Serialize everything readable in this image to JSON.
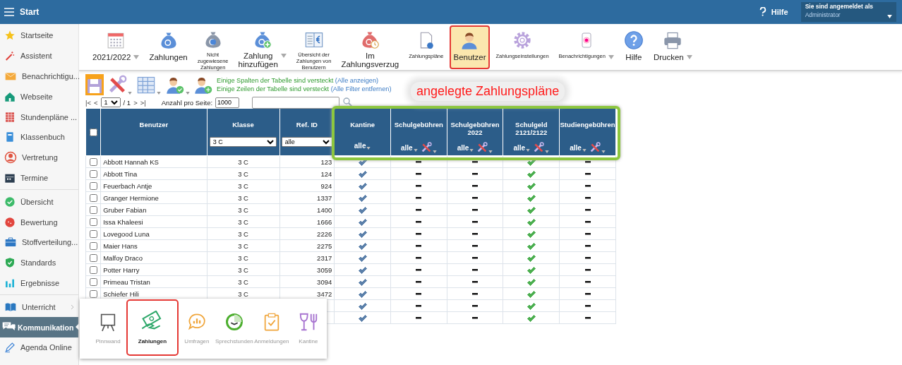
{
  "topbar": {
    "title": "Start",
    "help": "Hilfe",
    "login_label": "Sie sind angemeldet als",
    "user": "Administrator"
  },
  "sidebar": {
    "groups": [
      [
        {
          "label": "Startseite",
          "selected": false,
          "expandable": false
        },
        {
          "label": "Assistent",
          "selected": false,
          "expandable": false
        },
        {
          "label": "Benachrichtigu...",
          "selected": false,
          "expandable": false
        },
        {
          "label": "Webseite",
          "selected": false,
          "expandable": false
        },
        {
          "label": "Stundenpläne ...",
          "selected": false,
          "expandable": false
        },
        {
          "label": "Klassenbuch",
          "selected": false,
          "expandable": false
        },
        {
          "label": "Vertretung",
          "selected": false,
          "expandable": false
        },
        {
          "label": "Termine",
          "selected": false,
          "expandable": false
        }
      ],
      [
        {
          "label": "Übersicht",
          "selected": false,
          "expandable": false
        },
        {
          "label": "Bewertung",
          "selected": false,
          "expandable": false
        },
        {
          "label": "Stoffverteilung...",
          "selected": false,
          "expandable": false
        },
        {
          "label": "Standards",
          "selected": false,
          "expandable": false
        },
        {
          "label": "Ergebnisse",
          "selected": false,
          "expandable": false
        }
      ],
      [
        {
          "label": "Unterricht",
          "selected": false,
          "expandable": true
        },
        {
          "label": "Kommunikation",
          "selected": true,
          "expandable": false
        },
        {
          "label": "Agenda Online",
          "selected": false,
          "expandable": false
        }
      ]
    ]
  },
  "toolbar": {
    "items": [
      {
        "label": "2021/2022",
        "small": false,
        "dropdown": true,
        "selected": false,
        "highlighted": false
      },
      {
        "label": "Zahlungen",
        "small": false,
        "dropdown": false,
        "selected": false,
        "highlighted": false
      },
      {
        "label": "Nicht\nzugewiesene\nZahlungen",
        "small": true,
        "dropdown": false,
        "selected": false,
        "highlighted": false
      },
      {
        "label": "Zahlung\nhinzufügen",
        "small": false,
        "dropdown": true,
        "selected": false,
        "highlighted": false
      },
      {
        "label": "Übersicht der\nZahlungen von\nBenutzern",
        "small": true,
        "dropdown": false,
        "selected": false,
        "highlighted": false
      },
      {
        "label": "Im\nZahlungsverzug",
        "small": false,
        "dropdown": false,
        "selected": false,
        "highlighted": false
      },
      {
        "label": "Zahlungspläne",
        "small": true,
        "dropdown": false,
        "selected": false,
        "highlighted": false
      },
      {
        "label": "Benutzer",
        "small": false,
        "dropdown": false,
        "selected": true,
        "highlighted": true
      },
      {
        "label": "Zahlungseinstellungen",
        "small": true,
        "dropdown": false,
        "selected": false,
        "highlighted": false
      },
      {
        "label": "Benachrichtigungen",
        "small": true,
        "dropdown": true,
        "selected": false,
        "highlighted": false
      },
      {
        "label": "Hilfe",
        "small": false,
        "dropdown": false,
        "selected": false,
        "highlighted": false
      },
      {
        "label": "Drucken",
        "small": false,
        "dropdown": true,
        "selected": false,
        "highlighted": false
      }
    ]
  },
  "table_tools": [
    {
      "selected": true,
      "dropdown": false
    },
    {
      "selected": false,
      "dropdown": true
    },
    {
      "selected": false,
      "dropdown": true
    },
    {
      "selected": false,
      "dropdown": true
    },
    {
      "selected": false,
      "dropdown": false
    }
  ],
  "notices": [
    {
      "text": "Einige Spalten der Tabelle sind versteckt",
      "link": "(Alle anzeigen)"
    },
    {
      "text": "Einige Zeilen der Tabelle sind versteckt",
      "link": "(Alle Filter entfernen)"
    }
  ],
  "pager": {
    "first": "|<",
    "prev": "<",
    "page": "1",
    "of": "/ 1",
    "next": ">",
    "last": ">|",
    "per_page_label": "Anzahl pro Seite:",
    "per_page": "1000"
  },
  "annotation": {
    "text": "angelegte Zahlungspläne"
  },
  "table": {
    "select_all": false,
    "plans_highlighted": true,
    "columns": [
      {
        "label": "Benutzer",
        "kind": "name"
      },
      {
        "label": "Klasse",
        "kind": "select",
        "filter": "3 C"
      },
      {
        "label": "Ref. ID",
        "kind": "select",
        "filter": "alle"
      },
      {
        "label": "Kantine",
        "kind": "plan",
        "filter": "alle",
        "tools": false,
        "color": "#5b80aa"
      },
      {
        "label": "Schulgebühren",
        "kind": "plan",
        "filter": "alle",
        "tools": true
      },
      {
        "label": "Schulgebühren\n2022",
        "kind": "plan",
        "filter": "alle",
        "tools": true
      },
      {
        "label": "Schulgeld\n2121/2122",
        "kind": "plan",
        "filter": "alle",
        "tools": true,
        "color": "#4caf50"
      },
      {
        "label": "Studiengebühren",
        "kind": "plan",
        "filter": "alle",
        "tools": true
      }
    ],
    "rows": [
      {
        "checked": false,
        "name": "Abbott Hannah KS",
        "klasse": "3 C",
        "ref": "123",
        "plans": [
          true,
          false,
          false,
          true,
          false
        ]
      },
      {
        "checked": false,
        "name": "Abbott Tina",
        "klasse": "3 C",
        "ref": "124",
        "plans": [
          true,
          false,
          false,
          true,
          false
        ]
      },
      {
        "checked": false,
        "name": "Feuerbach Antje",
        "klasse": "3 C",
        "ref": "924",
        "plans": [
          true,
          false,
          false,
          true,
          false
        ]
      },
      {
        "checked": false,
        "name": "Granger Hermione",
        "klasse": "3 C",
        "ref": "1337",
        "plans": [
          true,
          false,
          false,
          true,
          false
        ]
      },
      {
        "checked": false,
        "name": "Gruber Fabian",
        "klasse": "3 C",
        "ref": "1400",
        "plans": [
          true,
          false,
          false,
          true,
          false
        ]
      },
      {
        "checked": false,
        "name": "Issa Khaleesi",
        "klasse": "3 C",
        "ref": "1666",
        "plans": [
          true,
          false,
          false,
          true,
          false
        ]
      },
      {
        "checked": false,
        "name": "Lovegood Luna",
        "klasse": "3 C",
        "ref": "2226",
        "plans": [
          true,
          false,
          false,
          true,
          false
        ]
      },
      {
        "checked": false,
        "name": "Maier Hans",
        "klasse": "3 C",
        "ref": "2275",
        "plans": [
          true,
          false,
          false,
          true,
          false
        ]
      },
      {
        "checked": false,
        "name": "Malfoy Draco",
        "klasse": "3 C",
        "ref": "2317",
        "plans": [
          true,
          false,
          false,
          true,
          false
        ]
      },
      {
        "checked": false,
        "name": "Potter Harry",
        "klasse": "3 C",
        "ref": "3059",
        "plans": [
          true,
          false,
          false,
          true,
          false
        ]
      },
      {
        "checked": false,
        "name": "Primeau Tristan",
        "klasse": "3 C",
        "ref": "3094",
        "plans": [
          true,
          false,
          false,
          true,
          false
        ]
      },
      {
        "checked": false,
        "name": "Schiefer Hili",
        "klasse": "3 C",
        "ref": "3472",
        "plans": [
          true,
          false,
          false,
          true,
          false
        ]
      },
      {
        "plans": [
          true,
          false,
          false,
          true,
          false
        ]
      },
      {
        "plans": [
          true,
          false,
          false,
          true,
          false
        ]
      }
    ]
  },
  "popup": {
    "items": [
      {
        "label": "Pinnwand",
        "selected": false,
        "highlighted": false
      },
      {
        "label": "Zahlungen",
        "selected": true,
        "highlighted": true
      },
      {
        "label": "Umfragen",
        "selected": false,
        "highlighted": false
      },
      {
        "label": "Sprechstunden",
        "selected": false,
        "highlighted": false
      },
      {
        "label": "Anmeldungen",
        "selected": false,
        "highlighted": false
      },
      {
        "label": "Kantine",
        "selected": false,
        "highlighted": false
      }
    ]
  }
}
